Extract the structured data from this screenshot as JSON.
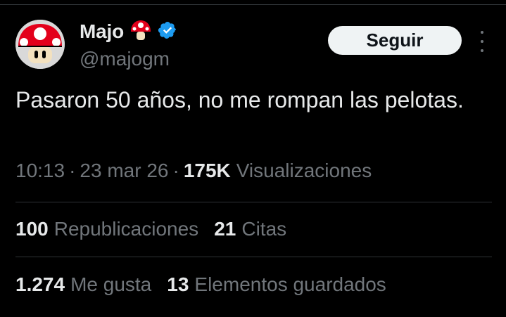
{
  "author": {
    "display_name": "Majo",
    "handle": "@majogm",
    "avatar_icon": "mushroom-icon",
    "name_emoji": "mushroom-icon",
    "verified_badge_icon": "verified-badge-icon"
  },
  "actions": {
    "follow_label": "Seguir",
    "more_icon": "more-vertical-icon"
  },
  "tweet": {
    "text": "Pasaron 50 años, no me rompan las pelotas."
  },
  "meta": {
    "time": "10:13",
    "separator": "·",
    "date": "23 mar 26",
    "views_count": "175K",
    "views_label": "Visualizaciones"
  },
  "stats": {
    "reposts_count": "100",
    "reposts_label": "Republicaciones",
    "quotes_count": "21",
    "quotes_label": "Citas",
    "likes_count": "1.274",
    "likes_label": "Me gusta",
    "bookmarks_count": "13",
    "bookmarks_label": "Elementos guardados"
  },
  "colors": {
    "background": "#000000",
    "primary_text": "#e7e9ea",
    "secondary_text": "#71767b",
    "divider": "#2f3336",
    "verified_blue": "#1d9bf0",
    "button_bg": "#eff3f4"
  }
}
